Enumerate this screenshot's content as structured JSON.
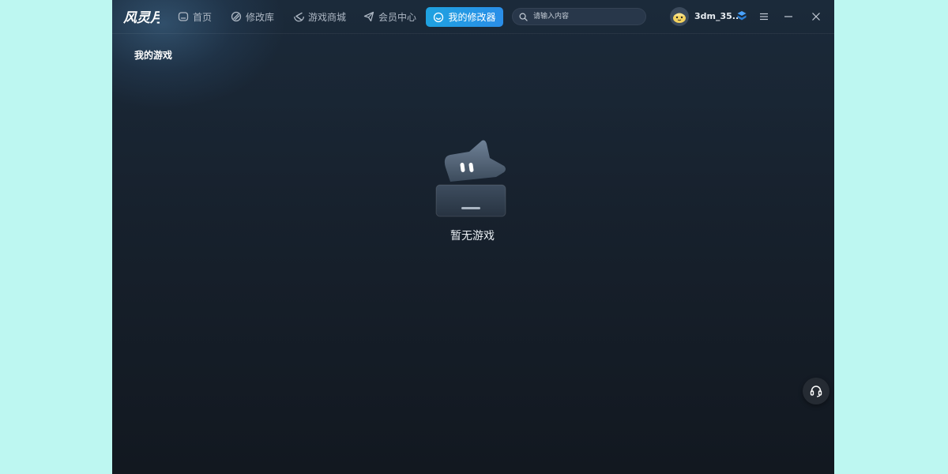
{
  "app": {
    "logo_text": "风灵月影"
  },
  "nav": {
    "items": [
      {
        "label": "首页",
        "icon": "home-icon"
      },
      {
        "label": "修改库",
        "icon": "library-icon"
      },
      {
        "label": "游戏商城",
        "icon": "store-icon"
      },
      {
        "label": "会员中心",
        "icon": "vip-plane-icon"
      }
    ],
    "active": {
      "label": "我的修改器",
      "icon": "smile-icon"
    }
  },
  "search": {
    "placeholder": "请输入内容",
    "value": ""
  },
  "user": {
    "name": "3dm_35..."
  },
  "main": {
    "section_title": "我的游戏",
    "empty_text": "暂无游戏"
  },
  "colors": {
    "accent": "#1fa2e0",
    "background": "#17212d",
    "page_background": "#bdf7f1"
  }
}
